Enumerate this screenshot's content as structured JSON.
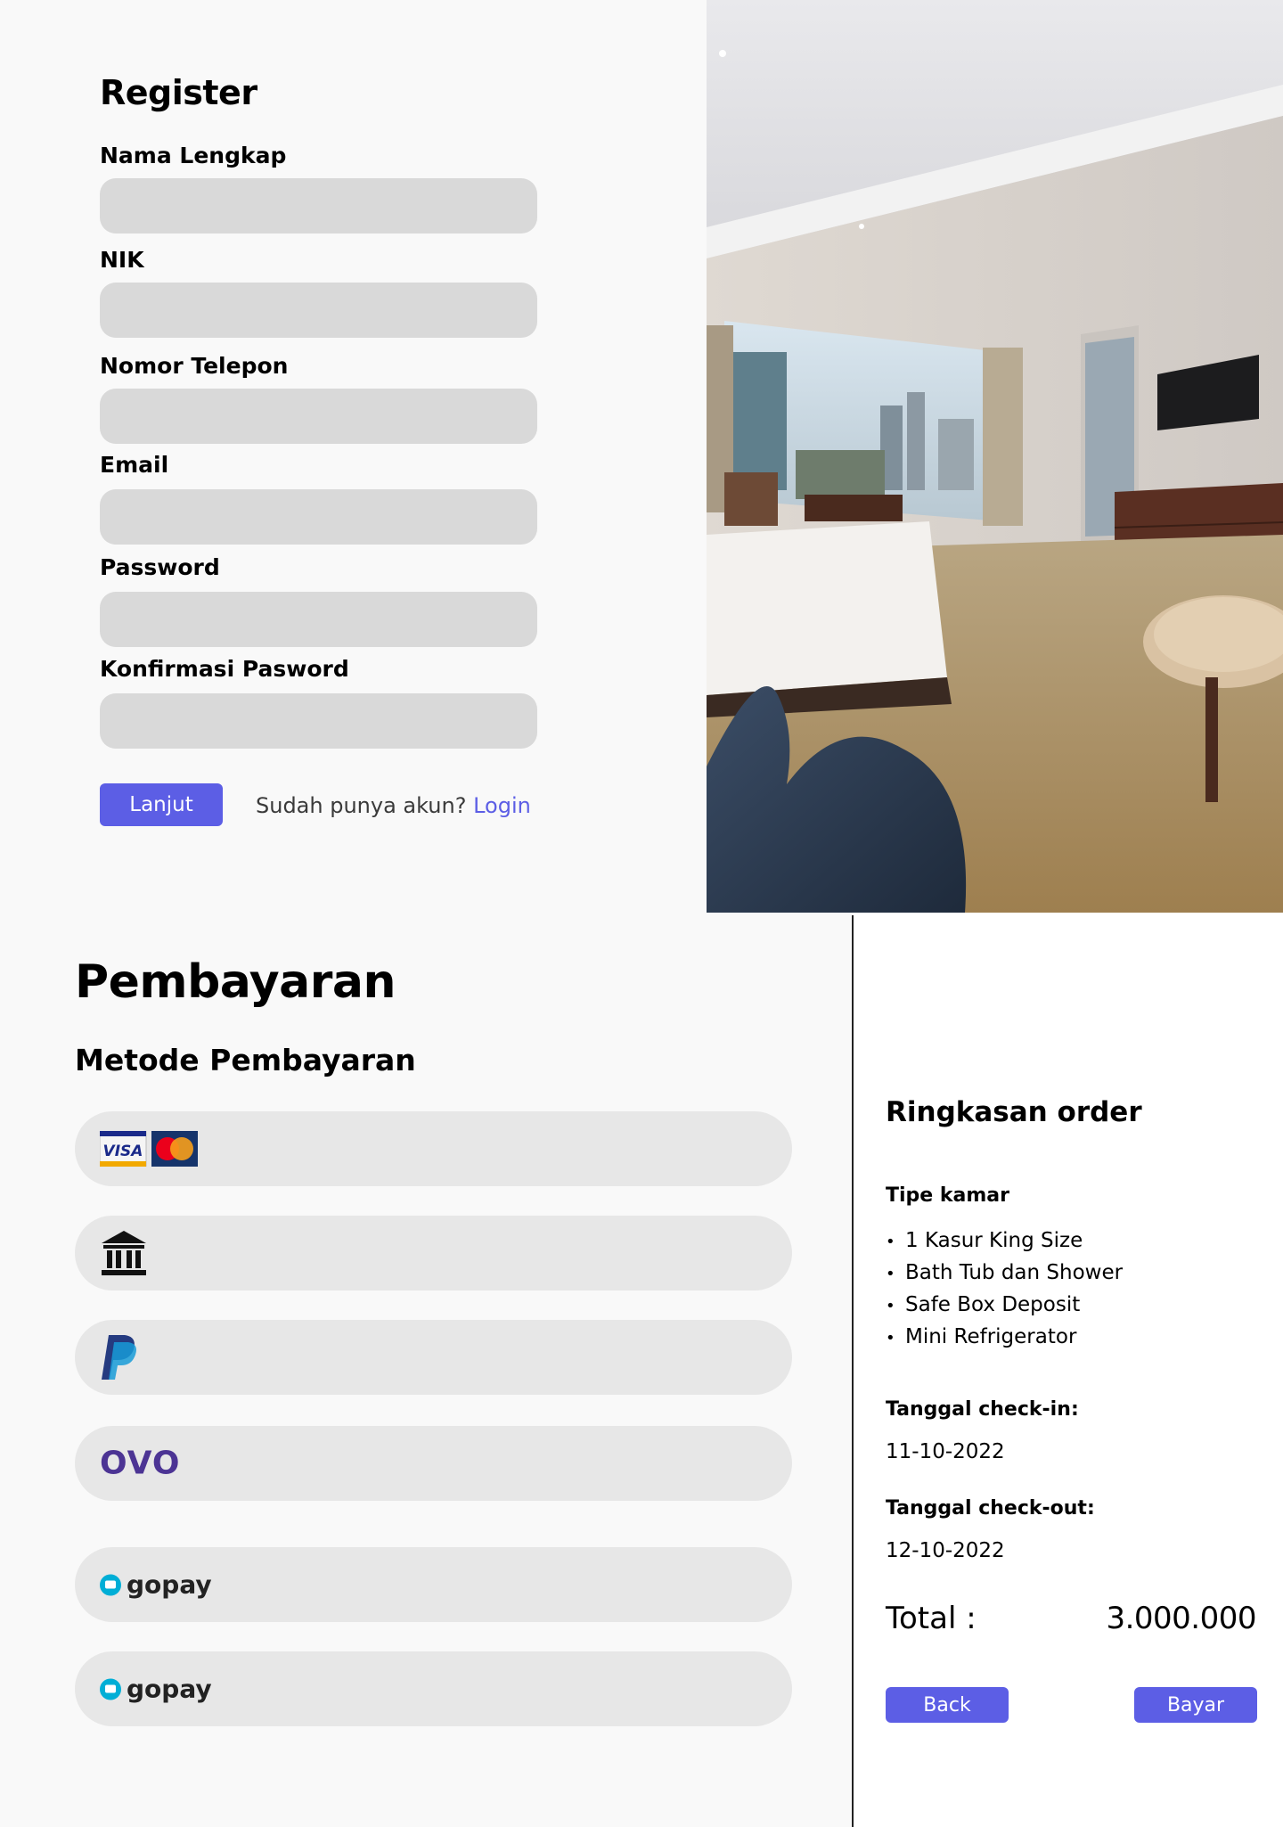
{
  "register": {
    "title": "Register",
    "fields": [
      {
        "label": "Nama Lengkap",
        "value": "",
        "placeholder": ""
      },
      {
        "label": "NIK",
        "value": "",
        "placeholder": ""
      },
      {
        "label": "Nomor Telepon",
        "value": "",
        "placeholder": ""
      },
      {
        "label": "Email",
        "value": "",
        "placeholder": ""
      },
      {
        "label": "Password",
        "value": "",
        "placeholder": ""
      },
      {
        "label": "Konfirmasi Pasword",
        "value": "",
        "placeholder": ""
      }
    ],
    "submit_label": "Lanjut",
    "login_prompt": "Sudah punya akun?",
    "login_link": "Login"
  },
  "hero_image": {
    "icon": "hotel-room-photo"
  },
  "payment": {
    "title": "Pembayaran",
    "subtitle": "Metode Pembayaran",
    "methods": [
      {
        "icon": "visa-mastercard-icon",
        "label": "VISA"
      },
      {
        "icon": "bank-icon",
        "label": ""
      },
      {
        "icon": "paypal-icon",
        "label": ""
      },
      {
        "icon": "ovo-icon",
        "label": "OVO"
      },
      {
        "icon": "gopay-icon",
        "label": "gopay"
      },
      {
        "icon": "gopay-icon",
        "label": "gopay"
      }
    ]
  },
  "summary": {
    "title": "Ringkasan order",
    "room_type_label": "Tipe kamar",
    "amenities": [
      "1 Kasur King Size",
      "Bath Tub dan Shower",
      "Safe Box Deposit",
      "Mini Refrigerator"
    ],
    "checkin_label": "Tanggal check-in",
    "checkin_value": "11-10-2022",
    "checkout_label": "Tanggal check-out",
    "checkout_value": "12-10-2022",
    "colon": ":",
    "total_label": "Total :",
    "total_value": "3.000.000",
    "back_label": "Back",
    "pay_label": "Bayar"
  },
  "colors": {
    "accent": "#5c5ee5",
    "input_bg": "#d9d9d9",
    "method_bg": "#e7e7e7",
    "ovo": "#4c3494",
    "gopay": "#00aed6"
  }
}
